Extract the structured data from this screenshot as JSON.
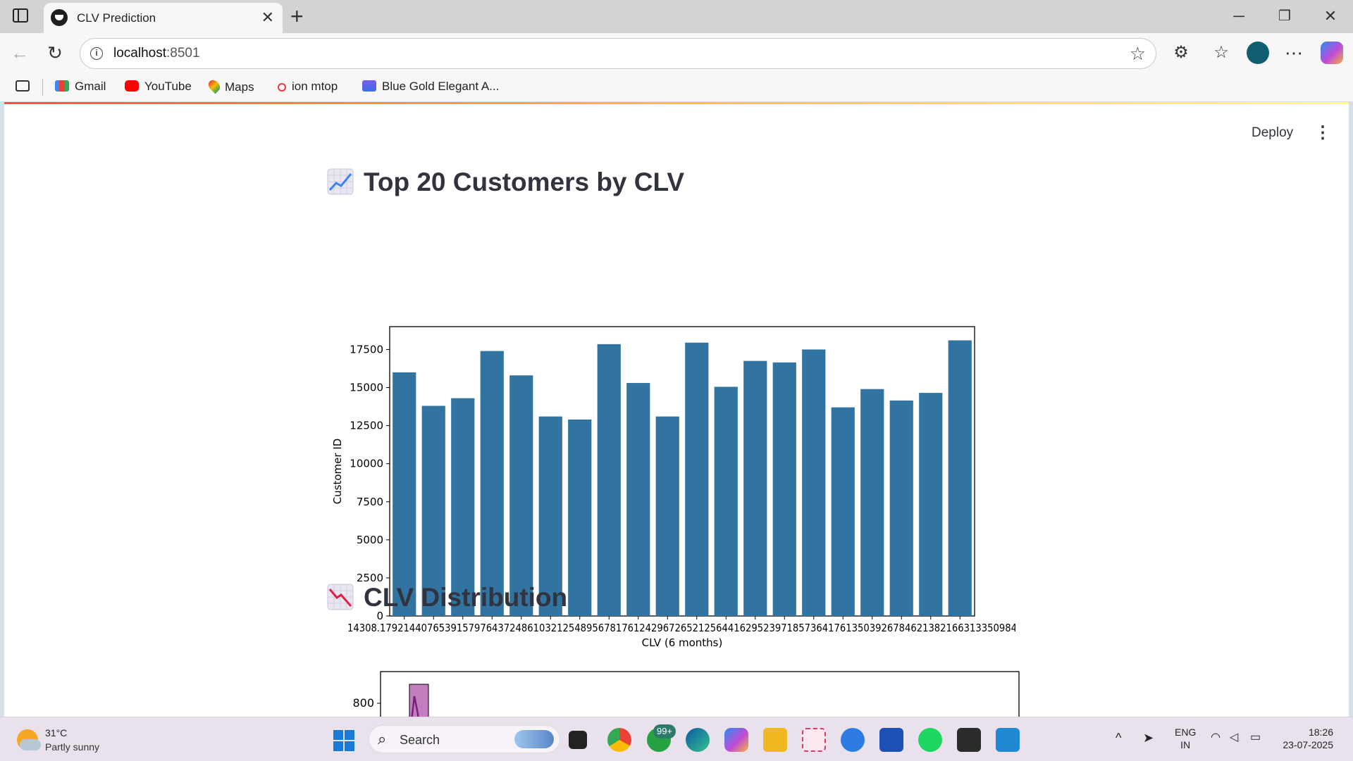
{
  "browser": {
    "tab_title": "CLV Prediction",
    "url_host": "localhost",
    "url_port": ":8501",
    "bookmarks": [
      "Gmail",
      "YouTube",
      "Maps",
      "ion mtop",
      "Blue Gold Elegant A..."
    ]
  },
  "app": {
    "deploy_label": "Deploy",
    "section1_title": "Top 20 Customers by CLV",
    "section2_title": "CLV Distribution"
  },
  "chart_data": [
    {
      "type": "bar",
      "xlabel": "CLV (6 months)",
      "ylabel": "Customer ID",
      "ylim": [
        0,
        19000
      ],
      "yticks": [
        0,
        2500,
        5000,
        7500,
        10000,
        12500,
        15000,
        17500
      ],
      "xtick_text": "14308.179214407653915797643724861032125489567817612429672652125644162952397185736417613503926784621382166313350984",
      "color": "#3274a1",
      "values": [
        16000,
        13800,
        14300,
        17400,
        15800,
        13100,
        12900,
        17850,
        15300,
        13100,
        17950,
        15050,
        16750,
        16650,
        17500,
        13700,
        14900,
        14150,
        14650,
        18100
      ]
    },
    {
      "type": "histogram",
      "yticks": [
        800
      ],
      "bar_color": "#c27ebf",
      "line_color": "#7b1f7a"
    }
  ],
  "taskbar": {
    "weather_temp": "31°C",
    "weather_desc": "Partly sunny",
    "search_label": "Search",
    "badge": "99+",
    "lang_top": "ENG",
    "lang_bottom": "IN",
    "time": "18:26",
    "date": "23-07-2025"
  }
}
